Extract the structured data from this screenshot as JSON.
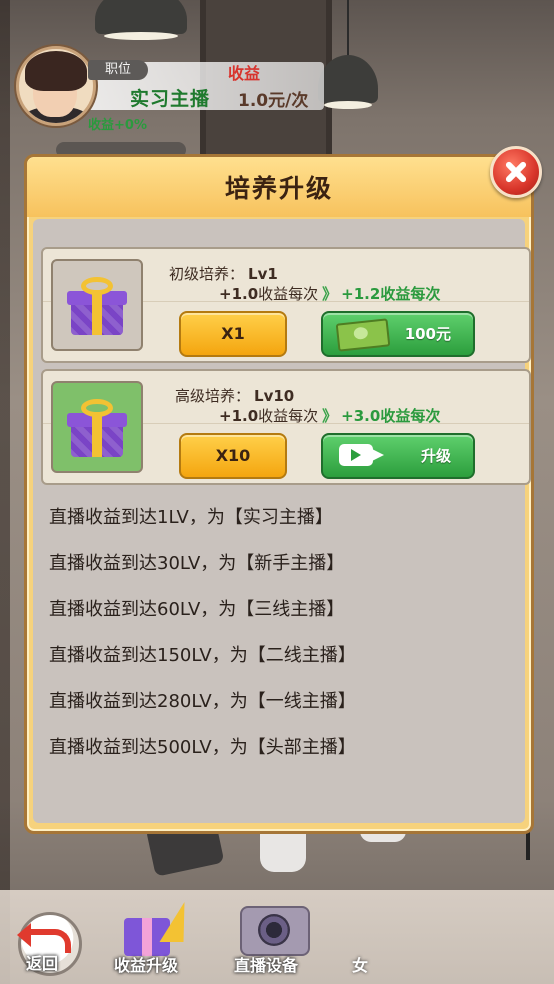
{
  "hud": {
    "position_label": "职位",
    "revenue_label": "收益",
    "position_name": "实习主播",
    "rate": "1.0元/次",
    "income_bonus": "收益+0%"
  },
  "dialog": {
    "title": "培养升级",
    "cards": [
      {
        "label": "初级培养：",
        "level": "Lv1",
        "gain_current": "+1.0",
        "gain_current_suffix": "收益每次",
        "arrow": "》",
        "gain_next": "+1.2收益每次",
        "multiplier": "X1",
        "action_label": "100元",
        "action_icon": "cash-icon"
      },
      {
        "label": "高级培养：",
        "level": "Lv10",
        "gain_current": "+1.0",
        "gain_current_suffix": "收益每次",
        "arrow": "》",
        "gain_next": "+3.0收益每次",
        "multiplier": "X10",
        "action_label": "升级",
        "action_icon": "video-icon"
      }
    ],
    "rules": [
      "直播收益到达1LV，为【实习主播】",
      "直播收益到达30LV，为【新手主播】",
      "直播收益到达60LV，为【三线主播】",
      "直播收益到达150LV，为【二线主播】",
      "直播收益到达280LV，为【一线主播】",
      "直播收益到达500LV，为【头部主播】"
    ]
  },
  "nav": {
    "back": "返回",
    "upgrade": "收益升级",
    "equipment": "直播设备",
    "more": "女"
  },
  "colors": {
    "dialog_bg": "#f6d27c",
    "gain_green": "#2b9a3e",
    "button_yellow": "#f4a50f",
    "button_green": "#2c9e3d",
    "close_red": "#d8352a"
  }
}
